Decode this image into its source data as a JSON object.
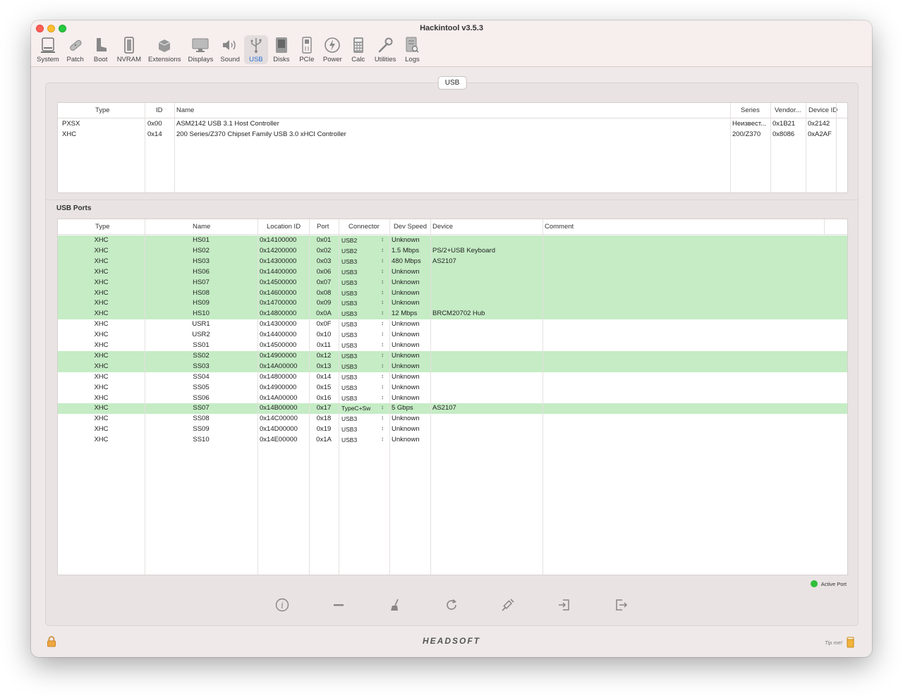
{
  "window": {
    "title": "Hackintool v3.5.3"
  },
  "toolbar": {
    "items": [
      {
        "label": "System",
        "icon": "system-icon"
      },
      {
        "label": "Patch",
        "icon": "patch-icon"
      },
      {
        "label": "Boot",
        "icon": "boot-icon"
      },
      {
        "label": "NVRAM",
        "icon": "nvram-icon"
      },
      {
        "label": "Extensions",
        "icon": "extensions-icon"
      },
      {
        "label": "Displays",
        "icon": "displays-icon"
      },
      {
        "label": "Sound",
        "icon": "sound-icon"
      },
      {
        "label": "USB",
        "icon": "usb-icon",
        "active": true
      },
      {
        "label": "Disks",
        "icon": "disks-icon"
      },
      {
        "label": "PCIe",
        "icon": "pcie-icon"
      },
      {
        "label": "Power",
        "icon": "power-icon"
      },
      {
        "label": "Calc",
        "icon": "calc-icon"
      },
      {
        "label": "Utilities",
        "icon": "utilities-icon"
      },
      {
        "label": "Logs",
        "icon": "logs-icon"
      }
    ]
  },
  "panel": {
    "tab_label": "USB"
  },
  "controllers": {
    "headers": {
      "type": "Type",
      "id": "ID",
      "name": "Name",
      "series": "Series",
      "vendor": "Vendor...",
      "device_id": "Device ID"
    },
    "rows": [
      {
        "type": "PXSX",
        "id": "0x00",
        "name": "ASM2142 USB 3.1 Host Controller",
        "series": "Неизвест...",
        "vendor": "0x1B21",
        "device_id": "0x2142"
      },
      {
        "type": "XHC",
        "id": "0x14",
        "name": "200 Series/Z370 Chipset Family USB 3.0 xHCI Controller",
        "series": "200/Z370",
        "vendor": "0x8086",
        "device_id": "0xA2AF"
      }
    ]
  },
  "ports": {
    "section_label": "USB Ports",
    "headers": {
      "type": "Type",
      "name": "Name",
      "location": "Location ID",
      "port": "Port",
      "connector": "Connector",
      "speed": "Dev Speed",
      "device": "Device",
      "comment": "Comment"
    },
    "rows": [
      {
        "type": "XHC",
        "name": "HS01",
        "location": "0x14100000",
        "port": "0x01",
        "connector": "USB2",
        "speed": "Unknown",
        "device": "",
        "active": true
      },
      {
        "type": "XHC",
        "name": "HS02",
        "location": "0x14200000",
        "port": "0x02",
        "connector": "USB2",
        "speed": "1.5 Mbps",
        "device": "PS/2+USB Keyboard",
        "active": true
      },
      {
        "type": "XHC",
        "name": "HS03",
        "location": "0x14300000",
        "port": "0x03",
        "connector": "USB3",
        "speed": "480 Mbps",
        "device": "AS2107",
        "active": true
      },
      {
        "type": "XHC",
        "name": "HS06",
        "location": "0x14400000",
        "port": "0x06",
        "connector": "USB3",
        "speed": "Unknown",
        "device": "",
        "active": true
      },
      {
        "type": "XHC",
        "name": "HS07",
        "location": "0x14500000",
        "port": "0x07",
        "connector": "USB3",
        "speed": "Unknown",
        "device": "",
        "active": true
      },
      {
        "type": "XHC",
        "name": "HS08",
        "location": "0x14600000",
        "port": "0x08",
        "connector": "USB3",
        "speed": "Unknown",
        "device": "",
        "active": true
      },
      {
        "type": "XHC",
        "name": "HS09",
        "location": "0x14700000",
        "port": "0x09",
        "connector": "USB3",
        "speed": "Unknown",
        "device": "",
        "active": true
      },
      {
        "type": "XHC",
        "name": "HS10",
        "location": "0x14800000",
        "port": "0x0A",
        "connector": "USB3",
        "speed": "12 Mbps",
        "device": "BRCM20702 Hub",
        "active": true
      },
      {
        "type": "XHC",
        "name": "USR1",
        "location": "0x14300000",
        "port": "0x0F",
        "connector": "USB3",
        "speed": "Unknown",
        "device": "",
        "active": false
      },
      {
        "type": "XHC",
        "name": "USR2",
        "location": "0x14400000",
        "port": "0x10",
        "connector": "USB3",
        "speed": "Unknown",
        "device": "",
        "active": false
      },
      {
        "type": "XHC",
        "name": "SS01",
        "location": "0x14500000",
        "port": "0x11",
        "connector": "USB3",
        "speed": "Unknown",
        "device": "",
        "active": false
      },
      {
        "type": "XHC",
        "name": "SS02",
        "location": "0x14900000",
        "port": "0x12",
        "connector": "USB3",
        "speed": "Unknown",
        "device": "",
        "active": true
      },
      {
        "type": "XHC",
        "name": "SS03",
        "location": "0x14A00000",
        "port": "0x13",
        "connector": "USB3",
        "speed": "Unknown",
        "device": "",
        "active": true
      },
      {
        "type": "XHC",
        "name": "SS04",
        "location": "0x14800000",
        "port": "0x14",
        "connector": "USB3",
        "speed": "Unknown",
        "device": "",
        "active": false
      },
      {
        "type": "XHC",
        "name": "SS05",
        "location": "0x14900000",
        "port": "0x15",
        "connector": "USB3",
        "speed": "Unknown",
        "device": "",
        "active": false
      },
      {
        "type": "XHC",
        "name": "SS06",
        "location": "0x14A00000",
        "port": "0x16",
        "connector": "USB3",
        "speed": "Unknown",
        "device": "",
        "active": false
      },
      {
        "type": "XHC",
        "name": "SS07",
        "location": "0x14B00000",
        "port": "0x17",
        "connector": "TypeC+Sw",
        "speed": "5 Gbps",
        "device": "AS2107",
        "active": true
      },
      {
        "type": "XHC",
        "name": "SS08",
        "location": "0x14C00000",
        "port": "0x18",
        "connector": "USB3",
        "speed": "Unknown",
        "device": "",
        "active": false
      },
      {
        "type": "XHC",
        "name": "SS09",
        "location": "0x14D00000",
        "port": "0x19",
        "connector": "USB3",
        "speed": "Unknown",
        "device": "",
        "active": false
      },
      {
        "type": "XHC",
        "name": "SS10",
        "location": "0x14E00000",
        "port": "0x1A",
        "connector": "USB3",
        "speed": "Unknown",
        "device": "",
        "active": false
      }
    ]
  },
  "legend": {
    "label": "Active Port",
    "color": "#2fbf3a"
  },
  "colors": {
    "active_row": "#c5ecc5",
    "accent": "#2c6fd6"
  },
  "actions": [
    "info-icon",
    "remove-icon",
    "clean-icon",
    "refresh-icon",
    "inject-icon",
    "import-icon",
    "export-icon"
  ],
  "footer": {
    "logo_text": "HEADSOFT",
    "tip_text": "Tip me!"
  }
}
